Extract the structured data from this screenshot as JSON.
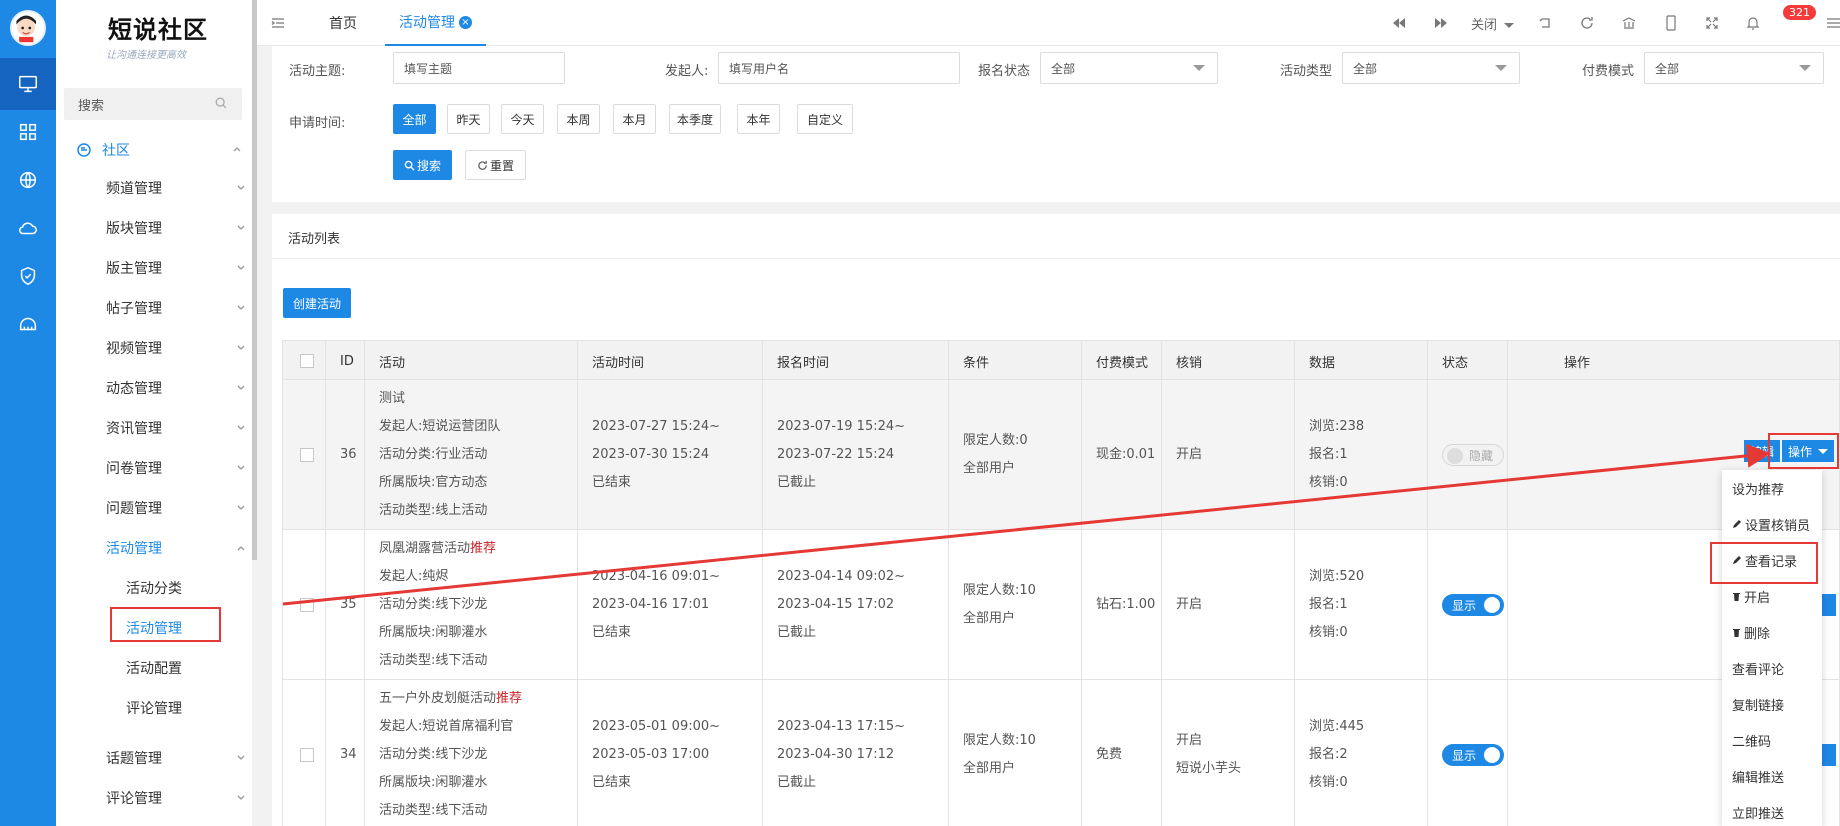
{
  "brand": {
    "title": "短说社区",
    "subtitle": "让沟通连接更高效"
  },
  "colors": {
    "primary": "#1e88e5",
    "rail": "#1e88e5",
    "highlight": "#e53935",
    "recommend": "#c62828"
  },
  "sidebar": {
    "search_placeholder": "搜索",
    "group": "社区",
    "items": [
      "频道管理",
      "版块管理",
      "版主管理",
      "帖子管理",
      "视频管理",
      "动态管理",
      "资讯管理",
      "问卷管理",
      "问题管理",
      "活动管理"
    ],
    "sub_items": [
      "活动分类",
      "活动管理",
      "活动配置",
      "评论管理"
    ],
    "bottom_items": [
      "话题管理",
      "评论管理"
    ]
  },
  "tabs": {
    "home": "首页",
    "current": "活动管理",
    "close_x": "×"
  },
  "toolbar": {
    "close_label": "关闭",
    "badge": "321"
  },
  "filters": {
    "topic_label": "活动主题:",
    "topic_placeholder": "填写主题",
    "initiator_label": "发起人:",
    "initiator_placeholder": "填写用户名",
    "signup_label": "报名状态",
    "signup_value": "全部",
    "type_label": "活动类型",
    "type_value": "全部",
    "pay_label": "付费模式",
    "pay_value": "全部",
    "time_label": "申请时间:",
    "chips": [
      "全部",
      "昨天",
      "今天",
      "本周",
      "本月",
      "本季度",
      "本年",
      "自定义"
    ],
    "search_btn": "搜索",
    "reset_btn": "重置"
  },
  "list": {
    "title": "活动列表",
    "create_btn": "创建活动",
    "headers": [
      "ID",
      "活动",
      "活动时间",
      "报名时间",
      "条件",
      "付费模式",
      "核销",
      "数据",
      "状态",
      "操作"
    ],
    "rows": [
      {
        "id": "36",
        "activity": [
          "测试",
          "发起人:短说运营团队",
          "活动分类:行业活动",
          "所属版块:官方动态",
          "活动类型:线上活动"
        ],
        "recommend": "",
        "time": [
          "2023-07-27 15:24~",
          "2023-07-30 15:24",
          "已结束"
        ],
        "signup": [
          "2023-07-19 15:24~",
          "2023-07-22 15:24",
          "已截止"
        ],
        "cond": [
          "限定人数:0",
          "全部用户"
        ],
        "pay": "现金:0.01",
        "verify": [
          "开启"
        ],
        "data": [
          "浏览:238",
          "报名:1",
          "核销:0"
        ],
        "status": "隐藏"
      },
      {
        "id": "35",
        "activity": [
          "凤凰湖露营活动",
          "发起人:纯烬",
          "活动分类:线下沙龙",
          "所属版块:闲聊灌水",
          "活动类型:线下活动"
        ],
        "recommend": "推荐",
        "time": [
          "2023-04-16 09:01~",
          "2023-04-16 17:01",
          "已结束"
        ],
        "signup": [
          "2023-04-14 09:02~",
          "2023-04-15 17:02",
          "已截止"
        ],
        "cond": [
          "限定人数:10",
          "全部用户"
        ],
        "pay": "钻石:1.00",
        "verify": [
          "开启"
        ],
        "data": [
          "浏览:520",
          "报名:1",
          "核销:0"
        ],
        "status": "显示"
      },
      {
        "id": "34",
        "activity": [
          "五一户外皮划艇活动",
          "发起人:短说首席福利官",
          "活动分类:线下沙龙",
          "所属版块:闲聊灌水",
          "活动类型:线下活动"
        ],
        "recommend": "推荐",
        "time": [
          "2023-05-01 09:00~",
          "2023-05-03 17:00",
          "已结束"
        ],
        "signup": [
          "2023-04-13 17:15~",
          "2023-04-30 17:12",
          "已截止"
        ],
        "cond": [
          "限定人数:10",
          "全部用户"
        ],
        "pay": "免费",
        "verify": [
          "开启",
          "短说小芋头"
        ],
        "data": [
          "浏览:445",
          "报名:2",
          "核销:0"
        ],
        "status": "显示"
      }
    ],
    "edit_btn": "编辑",
    "op_btn": "操作",
    "dropdown": [
      "设为推荐",
      "设置核销员",
      "查看记录",
      "开启",
      "删除",
      "查看评论",
      "复制链接",
      "二维码",
      "编辑推送",
      "立即推送"
    ]
  }
}
